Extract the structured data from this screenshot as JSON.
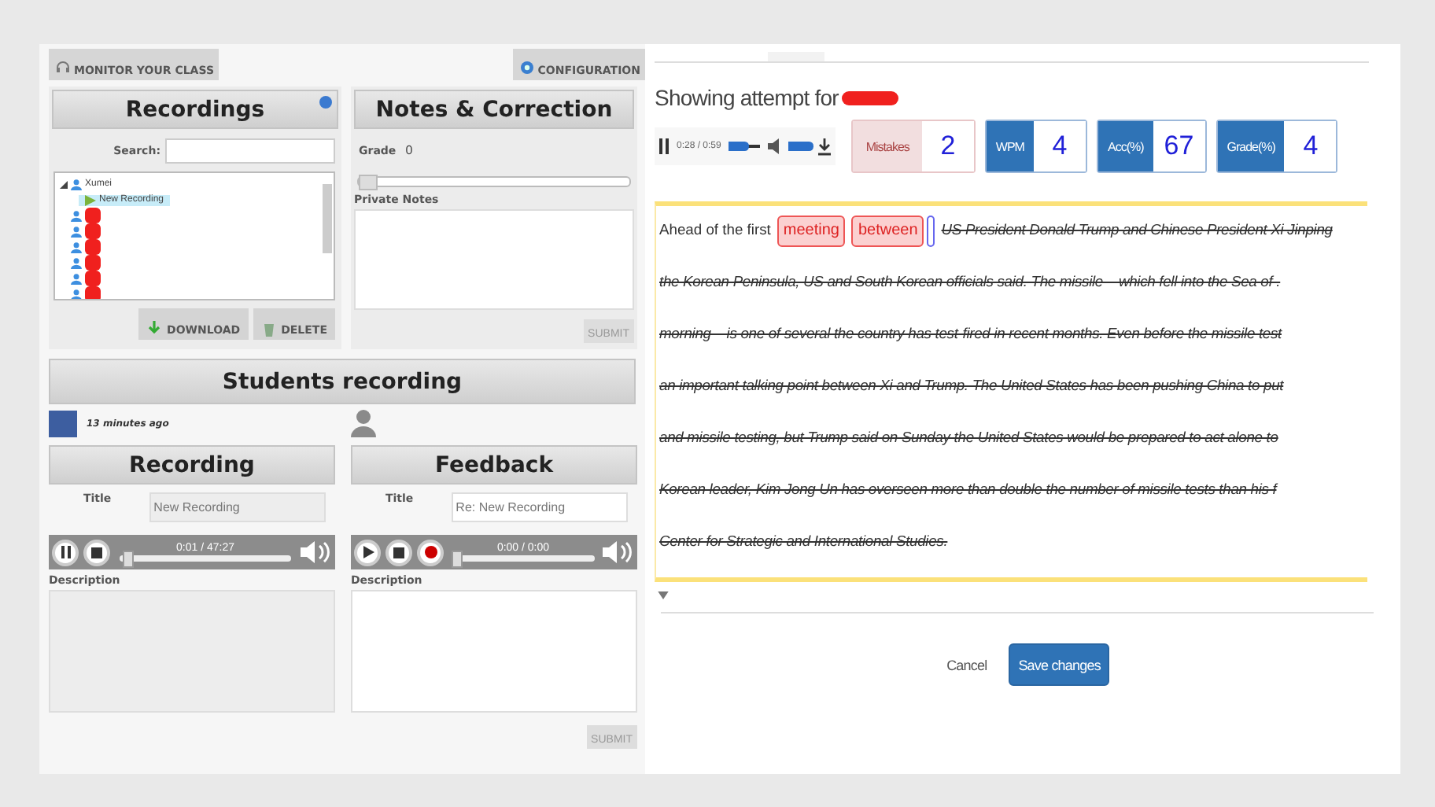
{
  "left": {
    "toolbar": {
      "monitor_button": "MONITOR YOUR CLASS",
      "config_button": "CONFIGURATION"
    },
    "recordings": {
      "title": "Recordings",
      "search_label": "Search:",
      "tree": [
        {
          "name": "Xumei",
          "expanded": true,
          "children": [
            {
              "name": "New Recording",
              "selected": true
            }
          ]
        },
        {
          "redacted": true
        },
        {
          "redacted": true
        },
        {
          "redacted": true
        },
        {
          "redacted": true
        },
        {
          "redacted": true
        },
        {
          "redacted": true
        }
      ],
      "buttons": [
        "DOWNLOAD",
        "DELETE"
      ]
    },
    "notes": {
      "title": "Notes & Correction",
      "grade_label": "Grade",
      "grade": "0",
      "grade_slider": {
        "level": 0
      },
      "private_notes_label": "Private Notes",
      "submit": "SUBMIT"
    },
    "students": {
      "title": "Students recording",
      "time": "13 minutes ago"
    },
    "panels": [
      {
        "title": "Recording",
        "title_label": "Title",
        "title_value": "New Recording",
        "disabled": true,
        "player": {
          "playing": true,
          "has_record": false,
          "time": "0:01 / 47:27",
          "level": 0.02
        },
        "description_label": "Description"
      },
      {
        "title": "Feedback",
        "title_label": "Title",
        "title_value": "Re: New Recording",
        "disabled": false,
        "player": {
          "playing": false,
          "has_record": true,
          "time": "0:00 / 0:00",
          "level": 0
        },
        "description_label": "Description",
        "submit": "SUBMIT"
      }
    ]
  },
  "right": {
    "heading": "Showing attempt for",
    "audio": {
      "playing": true,
      "time": "0:28 / 0:59",
      "level": 0.45,
      "volume": {
        "level": 0.8
      }
    },
    "stats": [
      {
        "label": "Mistakes",
        "value": "2",
        "kind": "error"
      },
      {
        "label": "WPM",
        "value": "4",
        "kind": "metric"
      },
      {
        "label": "Acc(%)",
        "value": "67",
        "kind": "metric"
      },
      {
        "label": "Grade(%)",
        "value": "4",
        "kind": "metric"
      }
    ],
    "passage": {
      "lines": [
        [
          {
            "kind": "plain",
            "text": "Ahead of the first"
          },
          {
            "kind": "error",
            "text": "meeting"
          },
          {
            "kind": "error",
            "text": "between"
          },
          {
            "kind": "cursor"
          },
          {
            "kind": "struck",
            "text": "US President Donald Trump and Chinese President Xi Jinping"
          }
        ],
        [
          {
            "kind": "struck",
            "text": "the Korean Peninsula, US and South Korean officials said. The missile – which fell into the Sea of ."
          }
        ],
        [
          {
            "kind": "struck",
            "text": "morning – is one of several the country has test-fired in recent months. Even before the missile test"
          }
        ],
        [
          {
            "kind": "struck",
            "text": "an important talking point between Xi and Trump. The United States has been pushing China to put"
          }
        ],
        [
          {
            "kind": "struck",
            "text": "and missile testing, but Trump said on Sunday the United States would be prepared to act alone to"
          }
        ],
        [
          {
            "kind": "struck",
            "text": "Korean leader, Kim Jong Un has overseen more than double the number of missile tests than his f"
          }
        ],
        [
          {
            "kind": "struck",
            "text": "Center for Strategic and International Studies."
          }
        ]
      ]
    },
    "footer": {
      "cancel": "Cancel",
      "save": "Save changes"
    }
  }
}
